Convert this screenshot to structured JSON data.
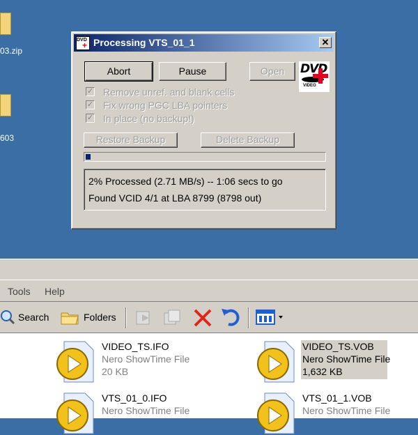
{
  "desktop": {
    "icons": [
      {
        "label": "03.zip"
      },
      {
        "label": "603"
      }
    ]
  },
  "dialog": {
    "title": "Processing VTS_01_1",
    "icon_text": "DVD",
    "close_glyph": "✕",
    "buttons": {
      "abort": "Abort",
      "pause": "Pause",
      "open": "Open",
      "restore_backup": "Restore Backup",
      "delete_backup": "Delete Backup"
    },
    "logo": {
      "text": "DVD",
      "sub": "VIDEO"
    },
    "checkboxes": [
      {
        "label": "Remove unref. and blank cells",
        "checked": true
      },
      {
        "label": "Fix wrong PGC LBA pointers",
        "checked": true
      },
      {
        "label": "In place (no backup!)",
        "checked": true
      }
    ],
    "progress_percent": 2,
    "status_lines": [
      "2% Processed (2.71 MB/s) -- 1:06 secs to go",
      "Found VCID 4/1 at LBA 8799 (8798 out)"
    ]
  },
  "explorer": {
    "menu": {
      "tools": "Tools",
      "help": "Help"
    },
    "toolbar": {
      "search": "Search",
      "folders": "Folders"
    },
    "files": [
      {
        "name": "VIDEO_TS.IFO",
        "type": "Nero ShowTime File",
        "size": "20 KB"
      },
      {
        "name": "VIDEO_TS.VOB",
        "type": "Nero ShowTime File",
        "size": "1,632 KB"
      },
      {
        "name": "VTS_01_0.IFO",
        "type": "Nero ShowTime File",
        "size": ""
      },
      {
        "name": "VTS_01_1.VOB",
        "type": "Nero ShowTime File",
        "size": ""
      }
    ]
  }
}
